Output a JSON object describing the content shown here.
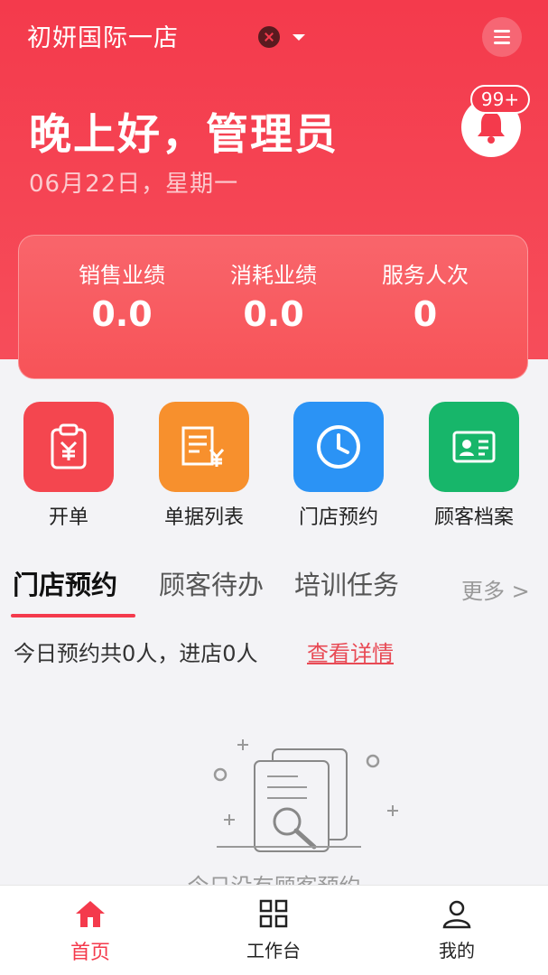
{
  "header": {
    "store_name": "初妍国际一店",
    "greeting": "晚上好，管理员",
    "date": "06月22日，星期一",
    "badge": "99+",
    "accent_color": "#f43a4c"
  },
  "stats": [
    {
      "label": "销售业绩",
      "value": "0.0"
    },
    {
      "label": "消耗业绩",
      "value": "0.0"
    },
    {
      "label": "服务人次",
      "value": "0"
    }
  ],
  "quick_actions": [
    {
      "label": "开单",
      "icon": "clipboard-yen-icon",
      "color": "#f4464f"
    },
    {
      "label": "单据列表",
      "icon": "receipt-yen-icon",
      "color": "#f7902d"
    },
    {
      "label": "门店预约",
      "icon": "clock-icon",
      "color": "#2b93f5"
    },
    {
      "label": "顾客档案",
      "icon": "id-card-icon",
      "color": "#17b66a"
    }
  ],
  "tabs": [
    {
      "label": "门店预约",
      "active": true
    },
    {
      "label": "顾客待办",
      "active": false
    },
    {
      "label": "培训任务",
      "active": false
    }
  ],
  "more_label": "更多 >",
  "summary_text": "今日预约共0人，进店0人",
  "detail_link": "查看详情",
  "empty_text": "今日没有顾客预约",
  "bottom_nav": [
    {
      "label": "首页",
      "icon": "home-icon",
      "active": true
    },
    {
      "label": "工作台",
      "icon": "grid-icon",
      "active": false
    },
    {
      "label": "我的",
      "icon": "user-icon",
      "active": false
    }
  ]
}
